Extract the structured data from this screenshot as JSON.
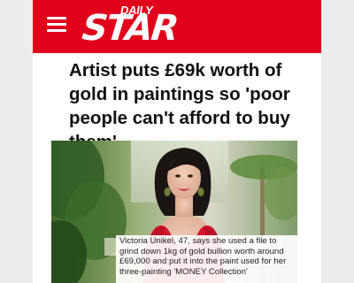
{
  "header": {
    "brand_small": "DAILY",
    "brand_large": "STAR",
    "accent_color": "#e0001b",
    "menu_icon": "hamburger-menu-icon"
  },
  "article": {
    "headline": "Artist puts £69k worth of gold in paintings so 'poor people can't afford to buy them'",
    "image": {
      "caption": "Victoria Unikel, 47, says she used a file to grind down 1kg of gold bullion worth around £69,000 and put it into the paint used for her three-painting 'MONEY Collection'"
    }
  }
}
